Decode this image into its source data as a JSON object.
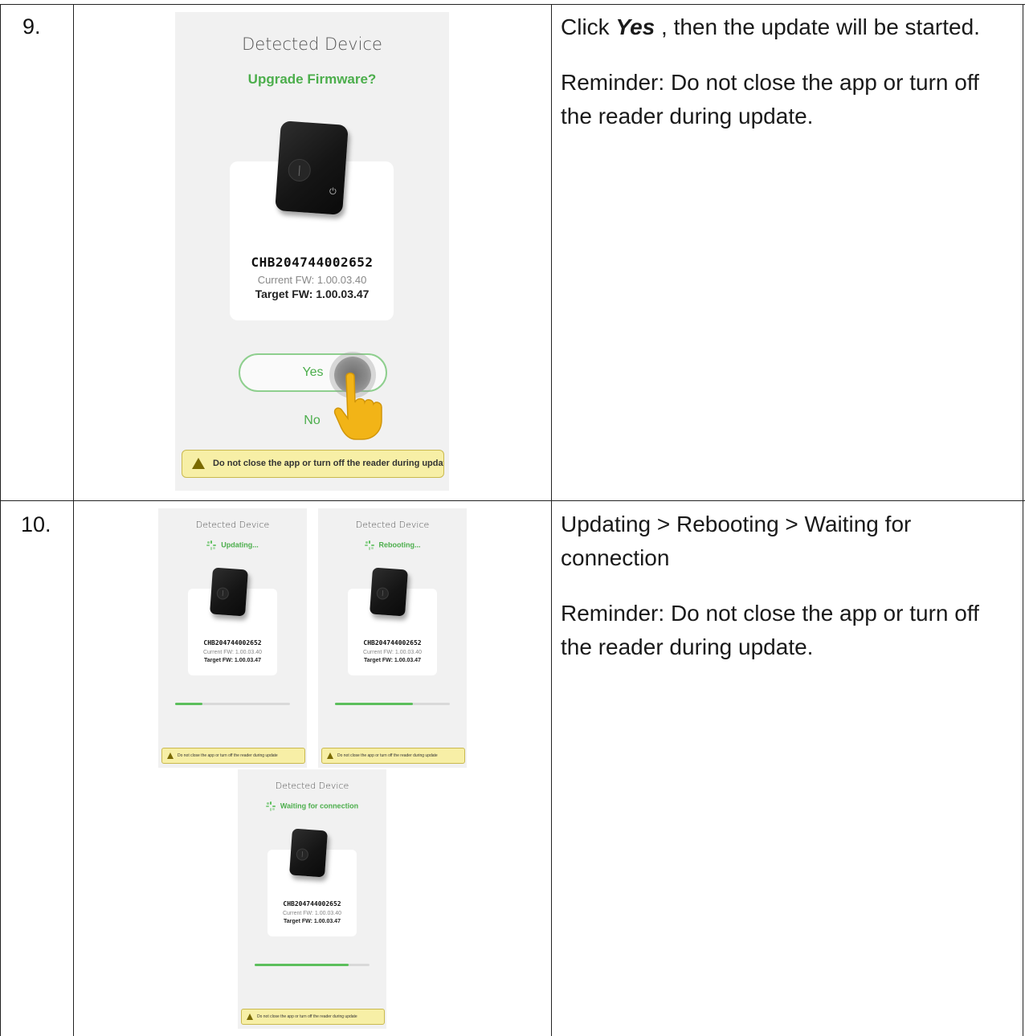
{
  "steps": [
    {
      "number": "9.",
      "description": {
        "line1_prefix": "Click ",
        "line1_emph": "Yes",
        "line1_suffix": " , then the update will be started.",
        "reminder": "Reminder: Do not close the app or turn off the reader during update."
      },
      "screen": {
        "title": "Detected Device",
        "status": "Upgrade Firmware?",
        "serial": "CHB204744002652",
        "current_fw": "Current FW: 1.00.03.40",
        "target_fw": "Target FW: 1.00.03.47",
        "yes_label": "Yes",
        "no_label": "No",
        "warning": "Do not close the app or turn off the reader during update"
      }
    },
    {
      "number": "10.",
      "description": {
        "line1": "Updating > Rebooting > Waiting for connection",
        "reminder": "Reminder: Do not close the app or turn off the reader during update."
      },
      "screens": [
        {
          "title": "Detected Device",
          "status": "Updating...",
          "serial": "CHB204744002652",
          "current_fw": "Current FW: 1.00.03.40",
          "target_fw": "Target FW: 1.00.03.47",
          "progress": 0.24,
          "warning": "Do not close the app or turn off the reader during update"
        },
        {
          "title": "Detected Device",
          "status": "Rebooting...",
          "serial": "CHB204744002652",
          "current_fw": "Current FW: 1.00.03.40",
          "target_fw": "Target FW: 1.00.03.47",
          "progress": 0.68,
          "warning": "Do not close the app or turn off the reader during update"
        },
        {
          "title": "Detected Device",
          "status": "Waiting for connection",
          "serial": "CHB204744002652",
          "current_fw": "Current FW: 1.00.03.40",
          "target_fw": "Target FW: 1.00.03.47",
          "progress": 0.82,
          "warning": "Do not close the app or turn off the reader during update"
        }
      ]
    }
  ],
  "colors": {
    "accent_green": "#4cae4c",
    "warning_bg": "#f7efa6",
    "touch_hand": "#f2b417"
  },
  "icons": [
    "warning-icon",
    "spinner-icon",
    "touch-hand-icon",
    "nfc-icon",
    "power-icon"
  ]
}
